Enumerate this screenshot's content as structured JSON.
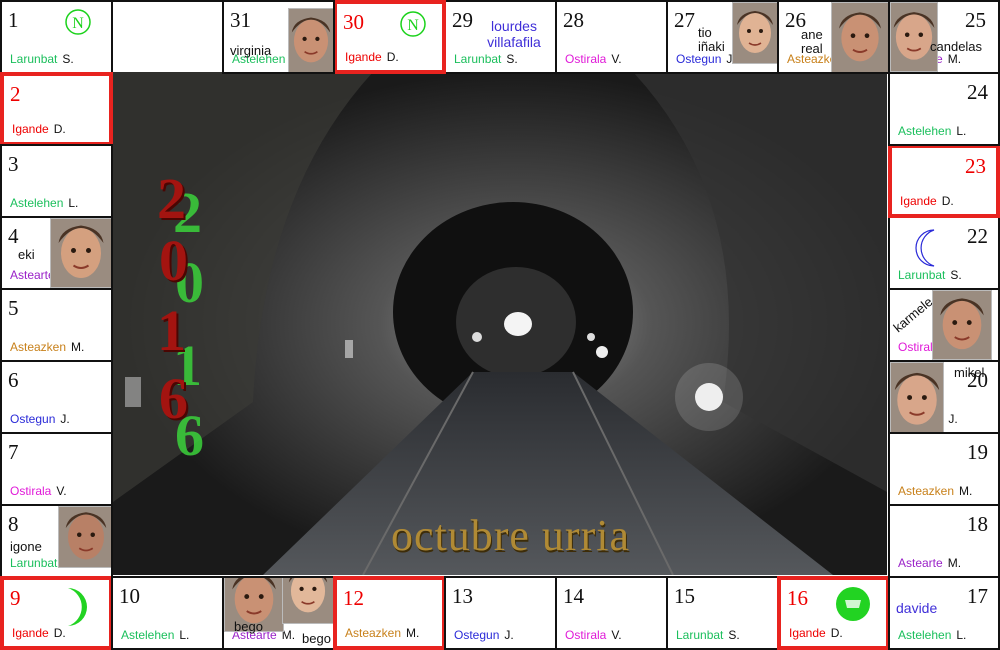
{
  "title": "octubre urria",
  "year_digits": [
    "2",
    "0",
    "1",
    "6"
  ],
  "days": [
    {
      "num": "1",
      "name": "Larunbat",
      "abbr": "S.",
      "name_color": "#1bbf5c",
      "sunday": false,
      "moon": "new-moon-icon"
    },
    {
      "num": "2",
      "name": "Igande",
      "abbr": "D.",
      "name_color": "#e00",
      "sunday": true
    },
    {
      "num": "3",
      "name": "Astelehen",
      "abbr": "L.",
      "name_color": "#1bbf5c",
      "sunday": false
    },
    {
      "num": "4",
      "name": "Astearte",
      "abbr": "M.",
      "name_color": "#9a22c8",
      "sunday": false,
      "person": "eki"
    },
    {
      "num": "5",
      "name": "Asteazken",
      "abbr": "M.",
      "name_color": "#c8811b",
      "sunday": false
    },
    {
      "num": "6",
      "name": "Ostegun",
      "abbr": "J.",
      "name_color": "#2a2ad8",
      "sunday": false
    },
    {
      "num": "7",
      "name": "Ostirala",
      "abbr": "V.",
      "name_color": "#e01ad8",
      "sunday": false
    },
    {
      "num": "8",
      "name": "Larunbat",
      "abbr": "S.",
      "name_color": "#1bbf5c",
      "sunday": false,
      "person": "igone"
    },
    {
      "num": "9",
      "name": "Igande",
      "abbr": "D.",
      "name_color": "#e00",
      "sunday": true,
      "moon": "first-quarter-moon-icon"
    },
    {
      "num": "10",
      "name": "Astelehen",
      "abbr": "L.",
      "name_color": "#1bbf5c",
      "sunday": false
    },
    {
      "num": "11",
      "name": "Astearte",
      "abbr": "M.",
      "name_color": "#9a22c8",
      "sunday": false,
      "person": "bego",
      "person2": "bego"
    },
    {
      "num": "12",
      "name": "Asteazken",
      "abbr": "M.",
      "name_color": "#c8811b",
      "sunday": true
    },
    {
      "num": "13",
      "name": "Ostegun",
      "abbr": "J.",
      "name_color": "#2a2ad8",
      "sunday": false
    },
    {
      "num": "14",
      "name": "Ostirala",
      "abbr": "V.",
      "name_color": "#e01ad8",
      "sunday": false
    },
    {
      "num": "15",
      "name": "Larunbat",
      "abbr": "S.",
      "name_color": "#1bbf5c",
      "sunday": false
    },
    {
      "num": "16",
      "name": "Igande",
      "abbr": "D.",
      "name_color": "#e00",
      "sunday": true,
      "moon": "full-moon-icon"
    },
    {
      "num": "17",
      "name": "Astelehen",
      "abbr": "L.",
      "name_color": "#1bbf5c",
      "sunday": false,
      "person": "davide"
    },
    {
      "num": "18",
      "name": "Astearte",
      "abbr": "M.",
      "name_color": "#9a22c8",
      "sunday": false
    },
    {
      "num": "19",
      "name": "Asteazken",
      "abbr": "M.",
      "name_color": "#c8811b",
      "sunday": false
    },
    {
      "num": "20",
      "name": "Ostegun",
      "abbr": "J.",
      "name_color": "#2a2ad8",
      "sunday": false,
      "person": "mikel"
    },
    {
      "num": "21",
      "name": "Ostirala",
      "abbr": "V.",
      "name_color": "#e01ad8",
      "sunday": false,
      "person": "karmele"
    },
    {
      "num": "22",
      "name": "Larunbat",
      "abbr": "S.",
      "name_color": "#1bbf5c",
      "sunday": false,
      "moon": "last-quarter-moon-icon"
    },
    {
      "num": "23",
      "name": "Igande",
      "abbr": "D.",
      "name_color": "#e00",
      "sunday": true
    },
    {
      "num": "24",
      "name": "Astelehen",
      "abbr": "L.",
      "name_color": "#1bbf5c",
      "sunday": false
    },
    {
      "num": "25",
      "name": "Astearte",
      "abbr": "M.",
      "name_color": "#9a22c8",
      "sunday": false,
      "person": "candelas"
    },
    {
      "num": "26",
      "name": "Asteazken",
      "abbr": "M.",
      "name_color": "#c8811b",
      "sunday": false,
      "person": "ane real"
    },
    {
      "num": "27",
      "name": "Ostegun",
      "abbr": "J.",
      "name_color": "#2a2ad8",
      "sunday": false,
      "person": "tio iñaki"
    },
    {
      "num": "28",
      "name": "Ostirala",
      "abbr": "V.",
      "name_color": "#e01ad8",
      "sunday": false
    },
    {
      "num": "29",
      "name": "Larunbat",
      "abbr": "S.",
      "name_color": "#1bbf5c",
      "sunday": false,
      "person": "lourdes villafafila"
    },
    {
      "num": "30",
      "name": "Igande",
      "abbr": "D.",
      "name_color": "#e00",
      "sunday": true,
      "moon": "new-moon-icon"
    },
    {
      "num": "31",
      "name": "Astelehen",
      "abbr": "L.",
      "name_color": "#1bbf5c",
      "sunday": false,
      "person": "virginia"
    }
  ]
}
